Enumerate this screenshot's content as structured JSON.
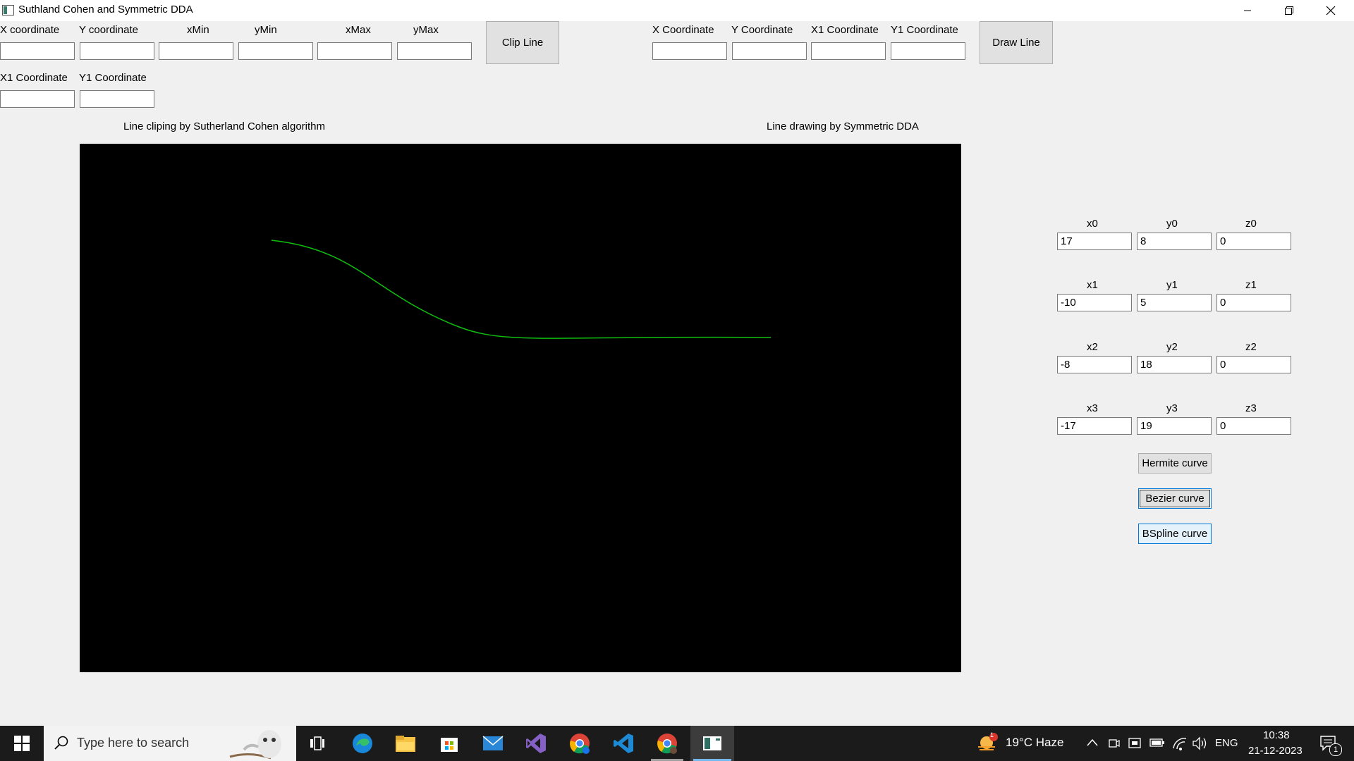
{
  "window": {
    "title": "Suthland Cohen and Symmetric DDA"
  },
  "clip": {
    "labels": [
      "X coordinate",
      "Y coordinate",
      "xMin",
      "yMin",
      "xMax",
      "yMax",
      "X1 Coordinate",
      "Y1 Coordinate"
    ],
    "values": [
      "",
      "",
      "",
      "",
      "",
      "",
      "",
      ""
    ],
    "button": "Clip Line",
    "caption": "Line cliping by Sutherland Cohen algorithm"
  },
  "dda": {
    "labels": [
      "X Coordinate",
      "Y Coordinate",
      "X1 Coordinate",
      "Y1 Coordinate"
    ],
    "values": [
      "",
      "",
      "",
      ""
    ],
    "button": "Draw Line",
    "caption": "Line drawing by Symmetric DDA"
  },
  "curve": {
    "points": [
      {
        "labels": [
          "x0",
          "y0",
          "z0"
        ],
        "values": [
          "17",
          "8",
          "0"
        ]
      },
      {
        "labels": [
          "x1",
          "y1",
          "z1"
        ],
        "values": [
          "-10",
          "5",
          "0"
        ]
      },
      {
        "labels": [
          "x2",
          "y2",
          "z2"
        ],
        "values": [
          "-8",
          "18",
          "0"
        ]
      },
      {
        "labels": [
          "x3",
          "y3",
          "z3"
        ],
        "values": [
          "-17",
          "19",
          "0"
        ]
      }
    ],
    "buttons": {
      "hermite": "Hermite curve",
      "bezier": "Bezier curve",
      "bspline": "BSpline curve"
    },
    "line_color": "#0fbf0f"
  },
  "taskbar": {
    "search_placeholder": "Type here to search",
    "weather": "19°C  Haze",
    "weather_badge": "1",
    "language": "ENG",
    "time": "10:38",
    "date": "21-12-2023",
    "notification_count": "1"
  }
}
